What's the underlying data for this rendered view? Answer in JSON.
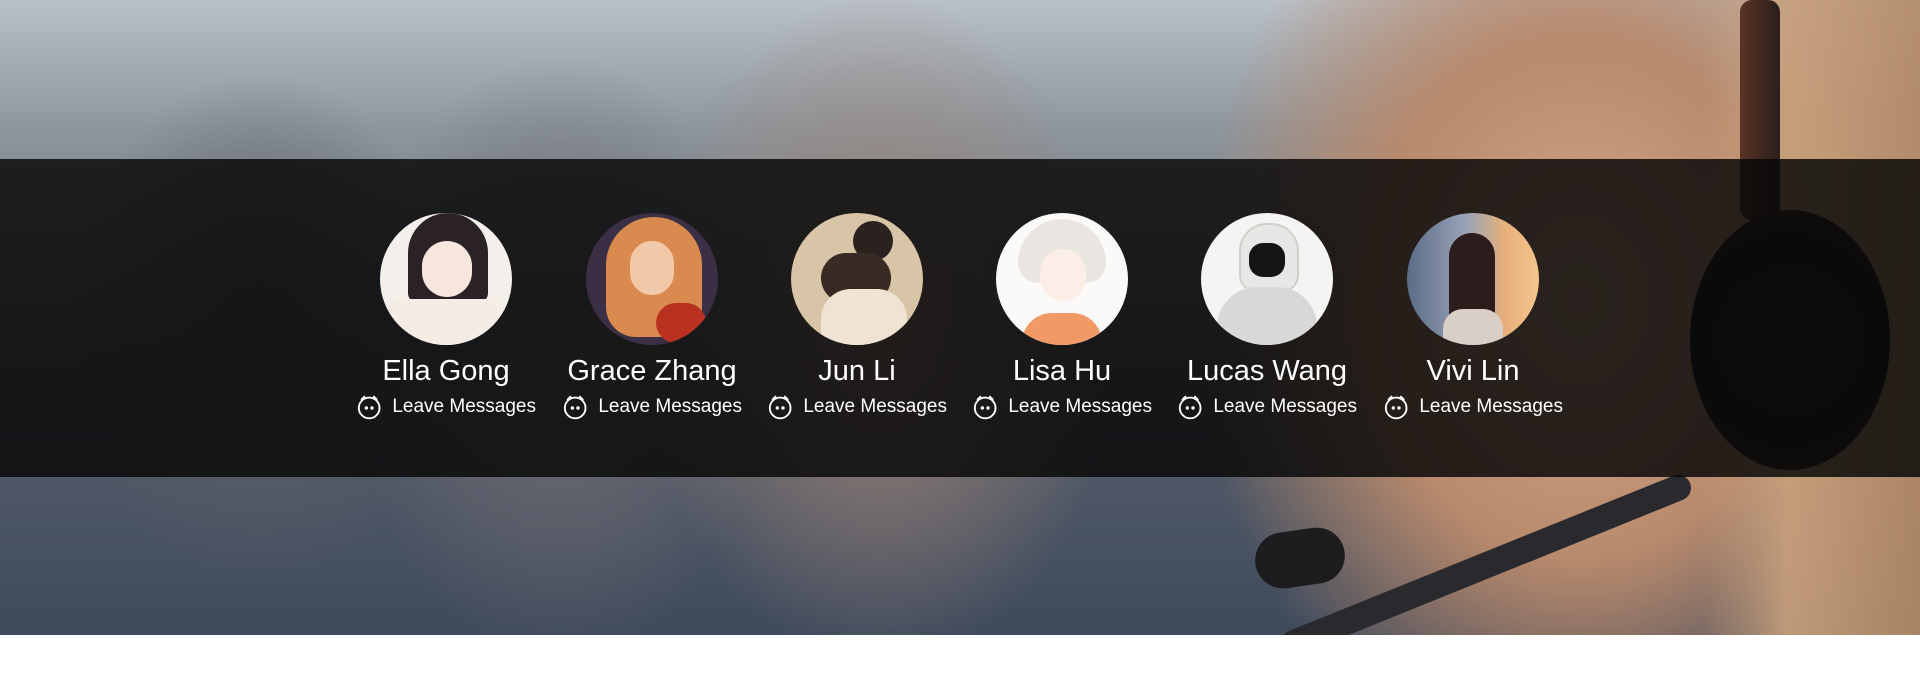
{
  "team": {
    "members": [
      {
        "name": "Ella Gong",
        "action_label": "Leave Messages",
        "action_icon": "chat-bubble-icon",
        "avatar": "anime-girl-dark-hair"
      },
      {
        "name": "Grace Zhang",
        "action_label": "Leave Messages",
        "action_icon": "chat-bubble-icon",
        "avatar": "illustrated-woman-red-hair"
      },
      {
        "name": "Jun Li",
        "action_label": "Leave Messages",
        "action_icon": "chat-bubble-icon",
        "avatar": "person-holding-cat"
      },
      {
        "name": "Lisa Hu",
        "action_label": "Leave Messages",
        "action_icon": "chat-bubble-icon",
        "avatar": "sketch-girl-white-hair"
      },
      {
        "name": "Lucas Wang",
        "action_label": "Leave Messages",
        "action_icon": "chat-bubble-icon",
        "avatar": "hooded-person"
      },
      {
        "name": "Vivi Lin",
        "action_label": "Leave Messages",
        "action_icon": "chat-bubble-icon",
        "avatar": "woman-at-window-sunset"
      }
    ]
  },
  "colors": {
    "band_overlay": "#080808",
    "text": "#ffffff",
    "page_background": "#ffffff"
  }
}
